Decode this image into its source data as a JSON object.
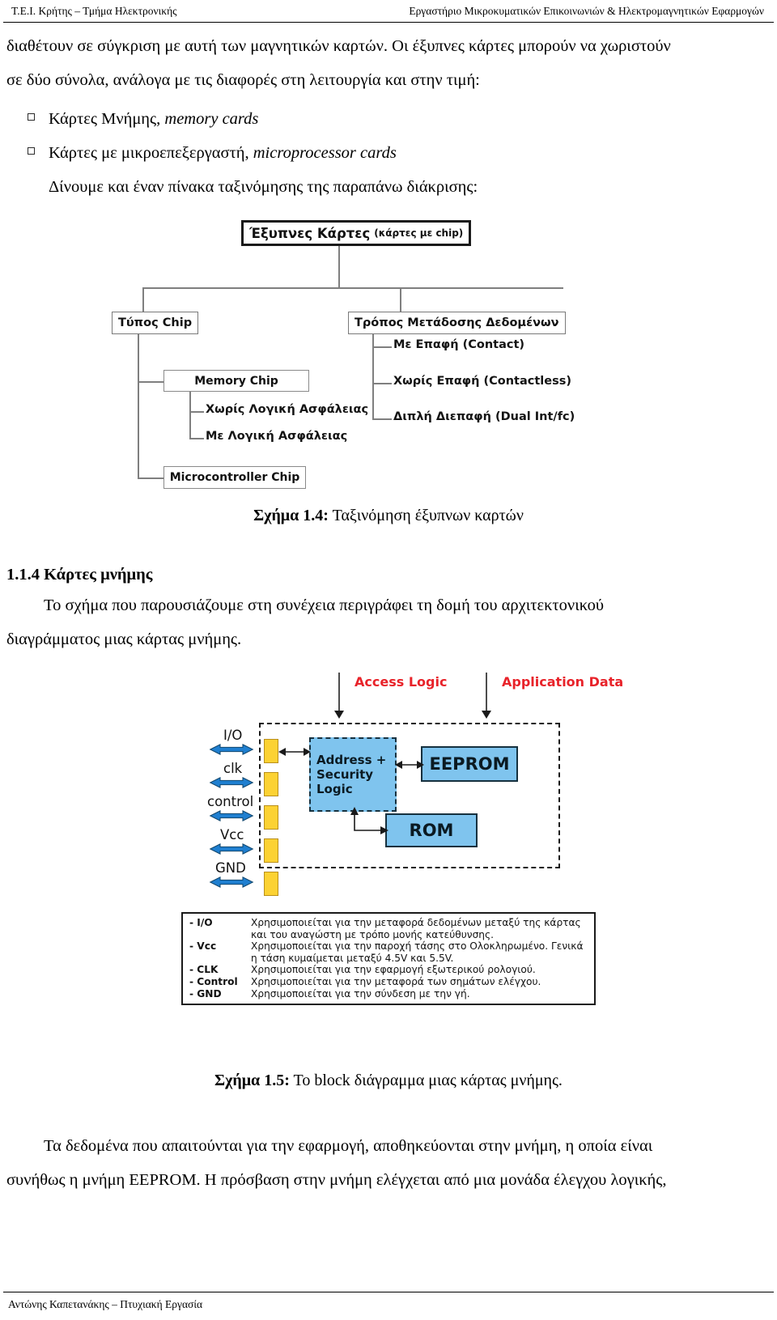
{
  "header": {
    "left": "Τ.Ε.Ι. Κρήτης – Τμήμα Ηλεκτρονικής",
    "right": "Εργαστήριο Μικροκυματικών Επικοινωνιών & Ηλεκτρομαγνητικών Εφαρμογών"
  },
  "body": {
    "paragraph1_a": "διαθέτουν σε σύγκριση με αυτή των μαγνητικών καρτών. Οι έξυπνες κάρτες μπορούν να χωριστούν",
    "paragraph1_b": "σε δύο σύνολα, ανάλογα με τις διαφορές στη λειτουργία και στην τιμή:",
    "bullet1_greek": "Κάρτες Μνήμης,",
    "bullet1_latin": "memory cards",
    "bullet2_greek": "Κάρτες με μικροεπεξεργαστή,",
    "bullet2_latin": "microprocessor cards",
    "after_bullets": "Δίνουμε και έναν πίνακα ταξινόμησης της παραπάνω διάκρισης:",
    "section_heading": "1.1.4  Κάρτες μνήμης",
    "paragraph2_a": "Το σχήμα που παρουσιάζουμε στη συνέχεια περιγράφει τη δομή του αρχιτεκτονικού",
    "paragraph2_b": "διαγράμματος μιας κάρτας μνήμης.",
    "paragraph3_a": "Τα δεδομένα που απαιτούνται για την εφαρμογή, αποθηκεύονται στην μνήμη, η οποία είναι",
    "paragraph3_b": "συνήθως η μνήμη EEPROM. Η πρόσβαση στην μνήμη ελέγχεται από μια μονάδα έλεγχου λογικής,"
  },
  "figure14": {
    "caption_label": "Σχήμα 1.4:",
    "caption_text": "Ταξινόμηση έξυπνων καρτών",
    "root_main": "Έξυπνες Κάρτες",
    "root_sub": "(κάρτες με chip)",
    "branch_left": "Τύπος Chip",
    "branch_right": "Τρόπος Μετάδοσης Δεδομένων",
    "left_child1": "Memory Chip",
    "left_child1_leaf1": "Χωρίς Λογική Ασφάλειας",
    "left_child1_leaf2": "Με Λογική Ασφάλειας",
    "left_child2": "Microcontroller Chip",
    "right_leaf1": "Με Επαφή (Contact)",
    "right_leaf2": "Χωρίς Επαφή (Contactless)",
    "right_leaf3": "Διπλή Διεπαφή (Dual Int/fc)",
    "colors": {
      "line": "#7f7f7f",
      "root_border": "#1a1a1a"
    }
  },
  "figure15": {
    "caption_label": "Σχήμα 1.5:",
    "caption_text": "Το block διάγραμμα μιας κάρτας μνήμης.",
    "annotation_left": "Access Logic",
    "annotation_right": "Application Data",
    "pins": [
      "I/O",
      "clk",
      "control",
      "Vcc",
      "GND"
    ],
    "block_logic_line1": "Address +",
    "block_logic_line2": "Security",
    "block_logic_line3": "Logic",
    "block_eeprom": "EEPROM",
    "block_rom": "ROM",
    "colors": {
      "annotation": "#e8232a",
      "block_fill": "#7fc4ee",
      "block_stroke": "#16313f",
      "pin_fill": "#fcd233",
      "arrow_blue": "#1f7fd0"
    },
    "legend": [
      {
        "key": "- I/O",
        "text": "Χρησιμοποιείται για την μεταφορά δεδομένων μεταξύ της κάρτας και του αναγώστη με τρόπο μονής κατεύθυνσης."
      },
      {
        "key": "- Vcc",
        "text": "Χρησιμοποιείται για την παροχή τάσης στο Ολοκληρωμένο. Γενικά η τάση κυμαίμεται μεταξύ 4.5V και 5.5V."
      },
      {
        "key": "- CLK",
        "text": "Χρησιμοποιείται για την εφαρμογή εξωτερικού ρολογιού."
      },
      {
        "key": "- Control",
        "text": "Χρησιμοποιείται για την μεταφορά των σημάτων ελέγχου."
      },
      {
        "key": "- GND",
        "text": "Χρησιμοποιείται για την σύνδεση με την γή."
      }
    ]
  },
  "footer": {
    "text": "Αντώνης Καπετανάκης – Πτυχιακή Εργασία"
  }
}
